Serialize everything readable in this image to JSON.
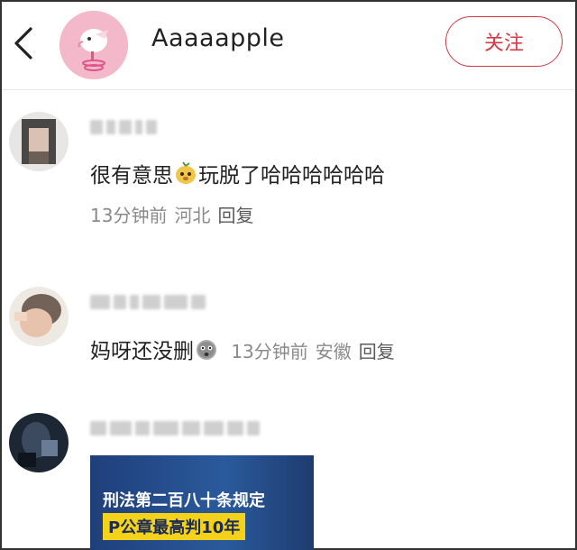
{
  "header": {
    "title": "Aaaaapple",
    "follow_label": "关注"
  },
  "comments": [
    {
      "text_a": "很有意思",
      "emoji_a": "pear-face-emoji",
      "text_b": "玩脱了哈哈哈哈哈哈",
      "time": "13分钟前",
      "location": "河北",
      "reply_label": "回复"
    },
    {
      "text": "妈呀还没删",
      "emoji": "worried-face-emoji",
      "time": "13分钟前",
      "location": "安徽",
      "reply_label": "回复"
    },
    {
      "thumb_line1": "刑法第二百八十条规定",
      "thumb_line2": "P公章最高判10年"
    }
  ],
  "colors": {
    "accent": "#d43a44",
    "meta_text": "#8a8a8a",
    "avatar_pink": "#f3b8c9"
  }
}
